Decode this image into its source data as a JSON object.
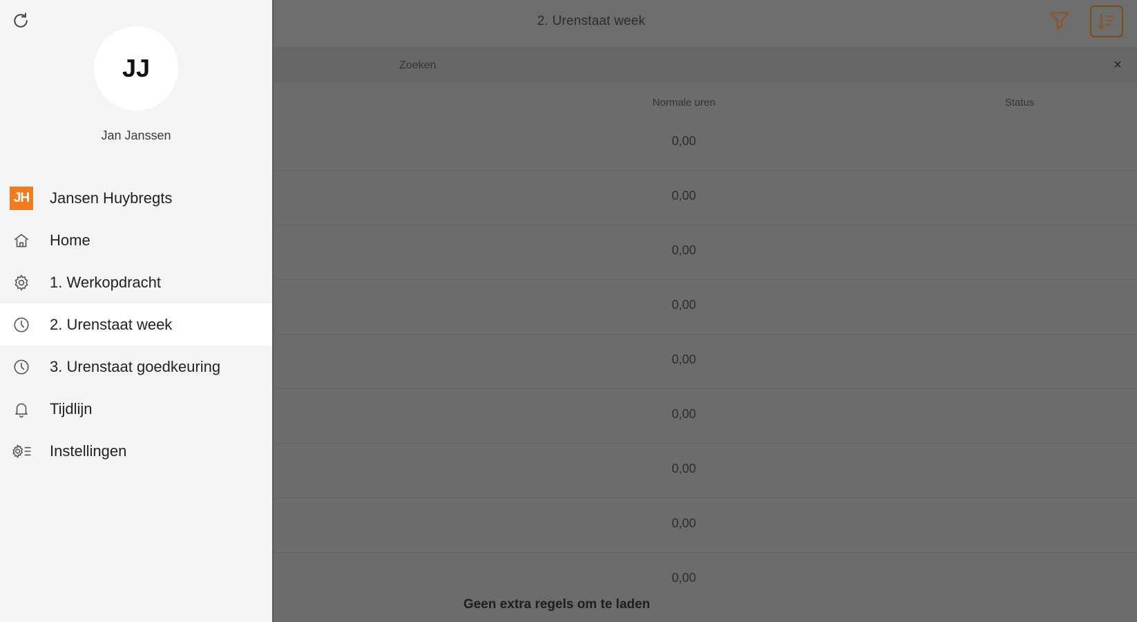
{
  "colors": {
    "accent": "#f07c1e",
    "sidebar_bg": "#f4f4f4",
    "overlay_bg": "#6c6c6c"
  },
  "sidebar": {
    "refresh_icon": "refresh-icon",
    "avatar_initials": "JJ",
    "user_name": "Jan Janssen",
    "company": {
      "logo_text": "JH",
      "label": "Jansen Huybregts"
    },
    "items": [
      {
        "label": "Home",
        "icon": "home-icon"
      },
      {
        "label": "1. Werkopdracht",
        "icon": "gear-icon"
      },
      {
        "label": "2. Urenstaat week",
        "icon": "clock-icon",
        "active": true
      },
      {
        "label": "3. Urenstaat goedkeuring",
        "icon": "clock-icon"
      },
      {
        "label": "Tijdlijn",
        "icon": "bell-icon"
      },
      {
        "label": "Instellingen",
        "icon": "settings-icon"
      }
    ]
  },
  "header": {
    "title": "2. Urenstaat week",
    "filter_icon": "filter-icon",
    "sort_icon": "sort-icon"
  },
  "search": {
    "placeholder": "Zoeken",
    "clear_label": "×"
  },
  "table": {
    "columns": [
      "Normale uren",
      "Status"
    ],
    "rows": [
      "0,00",
      "0,00",
      "0,00",
      "0,00",
      "0,00",
      "0,00",
      "0,00",
      "0,00",
      "0,00"
    ]
  },
  "footer": {
    "load_message": "Geen extra regels om te laden"
  }
}
